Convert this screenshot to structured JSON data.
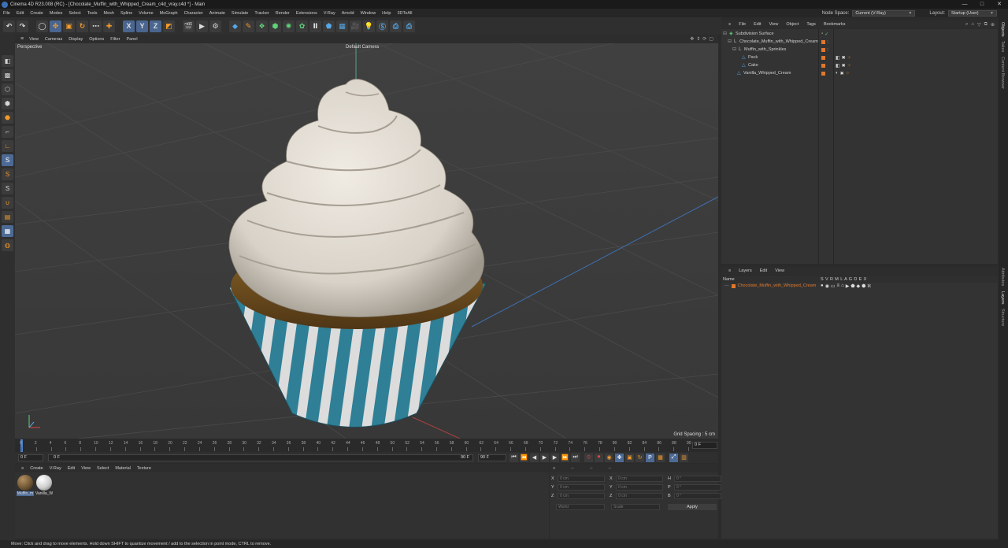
{
  "window": {
    "title": "Cinema 4D R23.008 (RC) - [Chocolate_Muffin_with_Whipped_Cream_c4d_vray.c4d *] - Main",
    "controls": [
      "—",
      "□",
      "✕"
    ]
  },
  "menu": {
    "items": [
      "File",
      "Edit",
      "Create",
      "Modes",
      "Select",
      "Tools",
      "Mesh",
      "Spline",
      "Volume",
      "MoGraph",
      "Character",
      "Animate",
      "Simulate",
      "Tracker",
      "Render",
      "Extensions",
      "V-Ray",
      "Arnold",
      "Window",
      "Help",
      "3DToAll"
    ],
    "node_space_label": "Node Space:",
    "node_space_value": "Current (V-Ray)",
    "layout_label": "Layout:",
    "layout_value": "Startup (User)"
  },
  "toolbar": {
    "axis_x": "X",
    "axis_y": "Y",
    "axis_z": "Z"
  },
  "viewport": {
    "menu": [
      "View",
      "Cameras",
      "Display",
      "Options",
      "Filter",
      "Panel"
    ],
    "projection": "Perspective",
    "camera": "Default Camera",
    "grid_spacing": "Grid Spacing : 5 cm"
  },
  "timeline": {
    "ticks": [
      "0",
      "2",
      "4",
      "6",
      "8",
      "10",
      "12",
      "14",
      "16",
      "18",
      "20",
      "22",
      "24",
      "26",
      "28",
      "30",
      "32",
      "34",
      "36",
      "38",
      "40",
      "42",
      "44",
      "46",
      "48",
      "50",
      "52",
      "54",
      "56",
      "58",
      "60",
      "62",
      "64",
      "66",
      "68",
      "70",
      "72",
      "74",
      "76",
      "78",
      "80",
      "82",
      "84",
      "86",
      "88",
      "90"
    ],
    "current_frame": "0 F"
  },
  "transport": {
    "start": "0 F",
    "preview_start": "0 F",
    "preview_end": "90 F",
    "end": "90 F"
  },
  "materials": {
    "menu": [
      "Create",
      "V-Ray",
      "Edit",
      "View",
      "Select",
      "Material",
      "Texture"
    ],
    "items": [
      {
        "label": "Muffin_m",
        "color": "#6a5232"
      },
      {
        "label": "Vanilla_W",
        "color": "#cfcfcf"
      }
    ]
  },
  "coords": {
    "menu": [
      "--",
      "--",
      "--"
    ],
    "rows": [
      {
        "a": "X",
        "v1": "0 cm",
        "b": "X",
        "v2": "0 cm",
        "c": "H",
        "v3": "0 °"
      },
      {
        "a": "Y",
        "v1": "0 cm",
        "b": "Y",
        "v2": "0 cm",
        "c": "P",
        "v3": "0 °"
      },
      {
        "a": "Z",
        "v1": "0 cm",
        "b": "Z",
        "v2": "0 cm",
        "c": "B",
        "v3": "0 °"
      }
    ],
    "space": "World",
    "mode": "Scale",
    "apply": "Apply"
  },
  "objects": {
    "menu": [
      "File",
      "Edit",
      "View",
      "Object",
      "Tags",
      "Bookmarks"
    ],
    "items": [
      {
        "name": "Subdivision Surface",
        "icon_color": "#5fd27a"
      },
      {
        "name": "Chocolate_Muffin_with_Whipped_Cream",
        "icon_color": "#bbbbbb"
      },
      {
        "name": "Muffin_with_Sprinkles",
        "icon_color": "#bbbbbb"
      },
      {
        "name": "Pack",
        "icon_color": "#55a7e6"
      },
      {
        "name": "Cake",
        "icon_color": "#55a7e6"
      },
      {
        "name": "Vanilla_Whipped_Cream",
        "icon_color": "#55a7e6"
      }
    ]
  },
  "layers": {
    "menu": [
      "Layers",
      "Edit",
      "View"
    ],
    "header_name": "Name",
    "header_cols": "S V R M L A G D E X",
    "items": [
      {
        "name": "Chocolate_Muffin_with_Whipped_Cream"
      }
    ]
  },
  "right_tabs": [
    "Objects",
    "Takes",
    "Content Browser",
    "Attributes",
    "Layers",
    "Structure"
  ],
  "status": "Move: Click and drag to move elements. Hold down SHIFT to quantize movement / add to the selection in point mode, CTRL to remove."
}
